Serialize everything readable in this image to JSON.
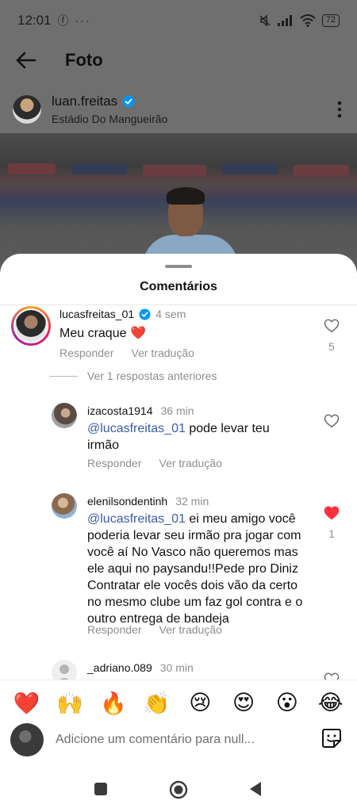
{
  "status_bar": {
    "time": "12:01",
    "left_icons": "ⓕ ···",
    "battery": "72"
  },
  "appbar": {
    "title": "Foto"
  },
  "post": {
    "username": "luan.freitas",
    "location": "Estádio Do Mangueirão"
  },
  "comments_sheet": {
    "title": "Comentários",
    "reply_label": "Responder",
    "translate_label": "Ver tradução",
    "replies_toggle": "Ver 1 respostas anteriores",
    "comments": [
      {
        "username": "lucasfreitas_01",
        "time": "4 sem",
        "text": "Meu craque ❤️",
        "likes": "5",
        "liked": false
      },
      {
        "username": "izacosta1914",
        "time": "36 min",
        "mention": "@lucasfreitas_01",
        "text": "pode levar teu irmão",
        "liked": false
      },
      {
        "username": "elenilsondentinh",
        "time": "32 min",
        "mention": "@lucasfreitas_01",
        "text": "ei meu amigo você poderia levar seu irmão pra jogar com você aí No Vasco não queremos mas ele aqui no paysandu!!Pede pro Diniz Contratar ele vocês dois vão da certo no mesmo clube um faz gol contra e o outro entrega de bandeja",
        "likes": "1",
        "liked": true
      },
      {
        "username": "_adriano.089",
        "time": "30 min",
        "liked": false
      }
    ]
  },
  "emoji_bar": [
    "❤️",
    "🙌",
    "🔥",
    "👏",
    "😢",
    "😍",
    "😮",
    "😂"
  ],
  "comment_input": {
    "placeholder": "Adicione um comentário para null..."
  },
  "colors": {
    "accent_blue": "#0095f6",
    "like_red": "#ff3040",
    "mention": "#3b5cae"
  }
}
